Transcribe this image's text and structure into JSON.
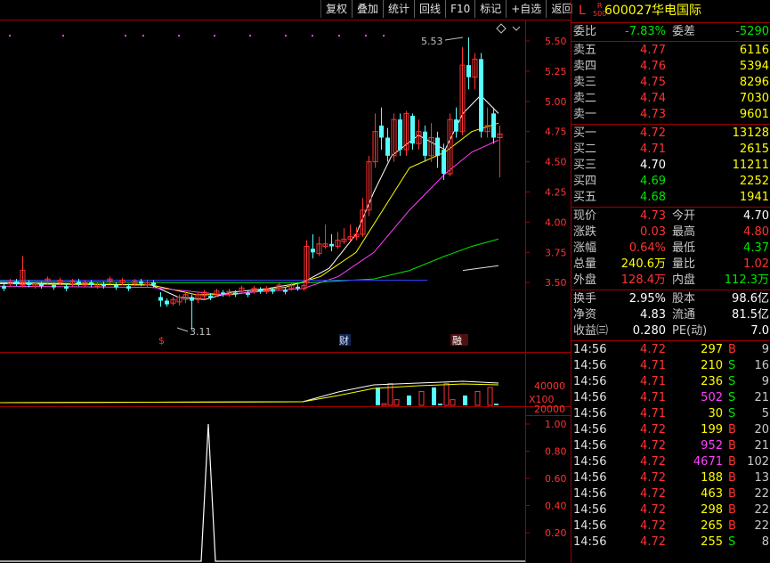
{
  "toolbar": {
    "items": [
      "复权",
      "叠加",
      "统计",
      "回线",
      "F10",
      "标记",
      "+自选",
      "返回"
    ]
  },
  "chart": {
    "price_axis": [
      "5.50",
      "5.25",
      "5.00",
      "4.75",
      "4.50",
      "4.25",
      "4.00",
      "3.75",
      "3.50"
    ],
    "volume_axis": [
      "40000",
      "20000"
    ],
    "volume_unit": "X100",
    "indicator_axis": [
      "1.00",
      "0.80",
      "0.60",
      "0.40",
      "0.20"
    ],
    "high_marker": "5.53",
    "low_marker": "3.11",
    "event_markers": [
      "$",
      "财",
      "融"
    ],
    "colors": {
      "up": "#ff3232",
      "down": "#54ffff",
      "ma5": "#ffffff",
      "ma10": "#ffff00",
      "ma20": "#ff40ff",
      "ma60": "#00e600",
      "axis": "#a00000"
    }
  },
  "quote": {
    "header": {
      "l": "L",
      "r": "R",
      "r_sub": "500",
      "code": "600027",
      "name": "华电国际"
    },
    "weibi": {
      "label": "委比",
      "value": "-7.83%",
      "label2": "委差",
      "value2": "-5290"
    },
    "asks": [
      {
        "label": "卖五",
        "price": "4.77",
        "vol": "6116"
      },
      {
        "label": "卖四",
        "price": "4.76",
        "vol": "5394"
      },
      {
        "label": "卖三",
        "price": "4.75",
        "vol": "8296"
      },
      {
        "label": "卖二",
        "price": "4.74",
        "vol": "7030"
      },
      {
        "label": "卖一",
        "price": "4.73",
        "vol": "9601"
      }
    ],
    "bids": [
      {
        "label": "买一",
        "price": "4.72",
        "vol": "13128",
        "c": "red"
      },
      {
        "label": "买二",
        "price": "4.71",
        "vol": "2615",
        "c": "red"
      },
      {
        "label": "买三",
        "price": "4.70",
        "vol": "11211",
        "c": "wht"
      },
      {
        "label": "买四",
        "price": "4.69",
        "vol": "2252",
        "c": "grn"
      },
      {
        "label": "买五",
        "price": "4.68",
        "vol": "1941",
        "c": "grn"
      }
    ],
    "stats": [
      {
        "l1": "现价",
        "v1": "4.73",
        "c1": "red",
        "l2": "今开",
        "v2": "4.70",
        "c2": "wht"
      },
      {
        "l1": "涨跌",
        "v1": "0.03",
        "c1": "red",
        "l2": "最高",
        "v2": "4.80",
        "c2": "red"
      },
      {
        "l1": "涨幅",
        "v1": "0.64%",
        "c1": "red",
        "l2": "最低",
        "v2": "4.37",
        "c2": "grn"
      },
      {
        "l1": "总量",
        "v1": "240.6万",
        "c1": "yel",
        "l2": "量比",
        "v2": "1.02",
        "c2": "red"
      },
      {
        "l1": "外盘",
        "v1": "128.4万",
        "c1": "red",
        "l2": "内盘",
        "v2": "112.3万",
        "c2": "grn"
      }
    ],
    "fundamentals": [
      {
        "l1": "换手",
        "v1": "2.95%",
        "l2": "股本",
        "v2": "98.6亿"
      },
      {
        "l1": "净资",
        "v1": "4.83",
        "l2": "流通",
        "v2": "81.5亿"
      },
      {
        "l1": "收益㈢",
        "v1": "0.280",
        "l2": "PE(动)",
        "v2": "7.0"
      }
    ],
    "ticks": [
      {
        "time": "14:56",
        "price": "4.72",
        "vol": "297",
        "vc": "yel",
        "bs": "B",
        "n": "9"
      },
      {
        "time": "14:56",
        "price": "4.71",
        "vol": "210",
        "vc": "yel",
        "bs": "S",
        "n": "16"
      },
      {
        "time": "14:56",
        "price": "4.71",
        "vol": "236",
        "vc": "yel",
        "bs": "S",
        "n": "9"
      },
      {
        "time": "14:56",
        "price": "4.71",
        "vol": "502",
        "vc": "mag",
        "bs": "S",
        "n": "21"
      },
      {
        "time": "14:56",
        "price": "4.71",
        "vol": "30",
        "vc": "yel",
        "bs": "S",
        "n": "5"
      },
      {
        "time": "14:56",
        "price": "4.72",
        "vol": "199",
        "vc": "yel",
        "bs": "B",
        "n": "20"
      },
      {
        "time": "14:56",
        "price": "4.72",
        "vol": "952",
        "vc": "mag",
        "bs": "B",
        "n": "21"
      },
      {
        "time": "14:56",
        "price": "4.72",
        "vol": "4671",
        "vc": "mag",
        "bs": "B",
        "n": "102"
      },
      {
        "time": "14:56",
        "price": "4.72",
        "vol": "188",
        "vc": "yel",
        "bs": "B",
        "n": "13"
      },
      {
        "time": "14:56",
        "price": "4.72",
        "vol": "463",
        "vc": "yel",
        "bs": "B",
        "n": "22"
      },
      {
        "time": "14:56",
        "price": "4.72",
        "vol": "298",
        "vc": "yel",
        "bs": "B",
        "n": "22"
      },
      {
        "time": "14:56",
        "price": "4.72",
        "vol": "265",
        "vc": "yel",
        "bs": "B",
        "n": "22"
      },
      {
        "time": "14:56",
        "price": "4.72",
        "vol": "255",
        "vc": "yel",
        "bs": "S",
        "n": "8"
      }
    ]
  }
}
